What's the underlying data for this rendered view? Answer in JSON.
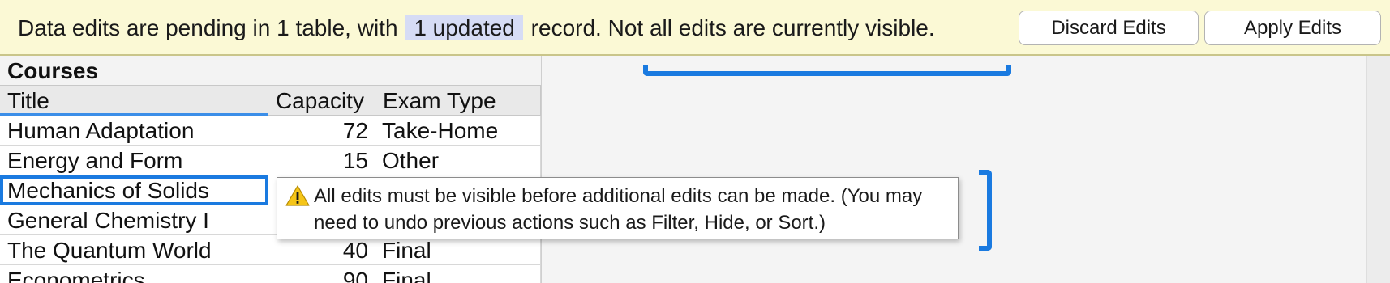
{
  "banner": {
    "message_before": "Data edits are pending in 1 table, with",
    "highlight": "1 updated",
    "message_after": "record. Not all edits are currently visible.",
    "discard_label": "Discard Edits",
    "apply_label": "Apply Edits"
  },
  "table": {
    "title": "Courses",
    "columns": [
      "Title",
      "Capacity",
      "Exam Type"
    ],
    "rows": [
      {
        "title": "Human Adaptation",
        "capacity": "72",
        "exam": "Take-Home"
      },
      {
        "title": "Energy and Form",
        "capacity": "15",
        "exam": "Other"
      },
      {
        "title": "Mechanics of Solids",
        "capacity": "",
        "exam": ""
      },
      {
        "title": "General Chemistry I",
        "capacity": "",
        "exam": ""
      },
      {
        "title": "The Quantum World",
        "capacity": "40",
        "exam": "Final"
      },
      {
        "title": "Econometrics",
        "capacity": "90",
        "exam": "Final"
      }
    ]
  },
  "tooltip": {
    "icon": "warning-icon",
    "text": "All edits must be visible before additional edits can be made. (You may need to undo previous actions such as Filter, Hide, or Sort.)"
  },
  "colors": {
    "banner_bg": "#fbf9d5",
    "highlight_bg": "#d6dcf5",
    "selection_blue": "#1a7ae0",
    "warning_yellow": "#f5c518"
  }
}
